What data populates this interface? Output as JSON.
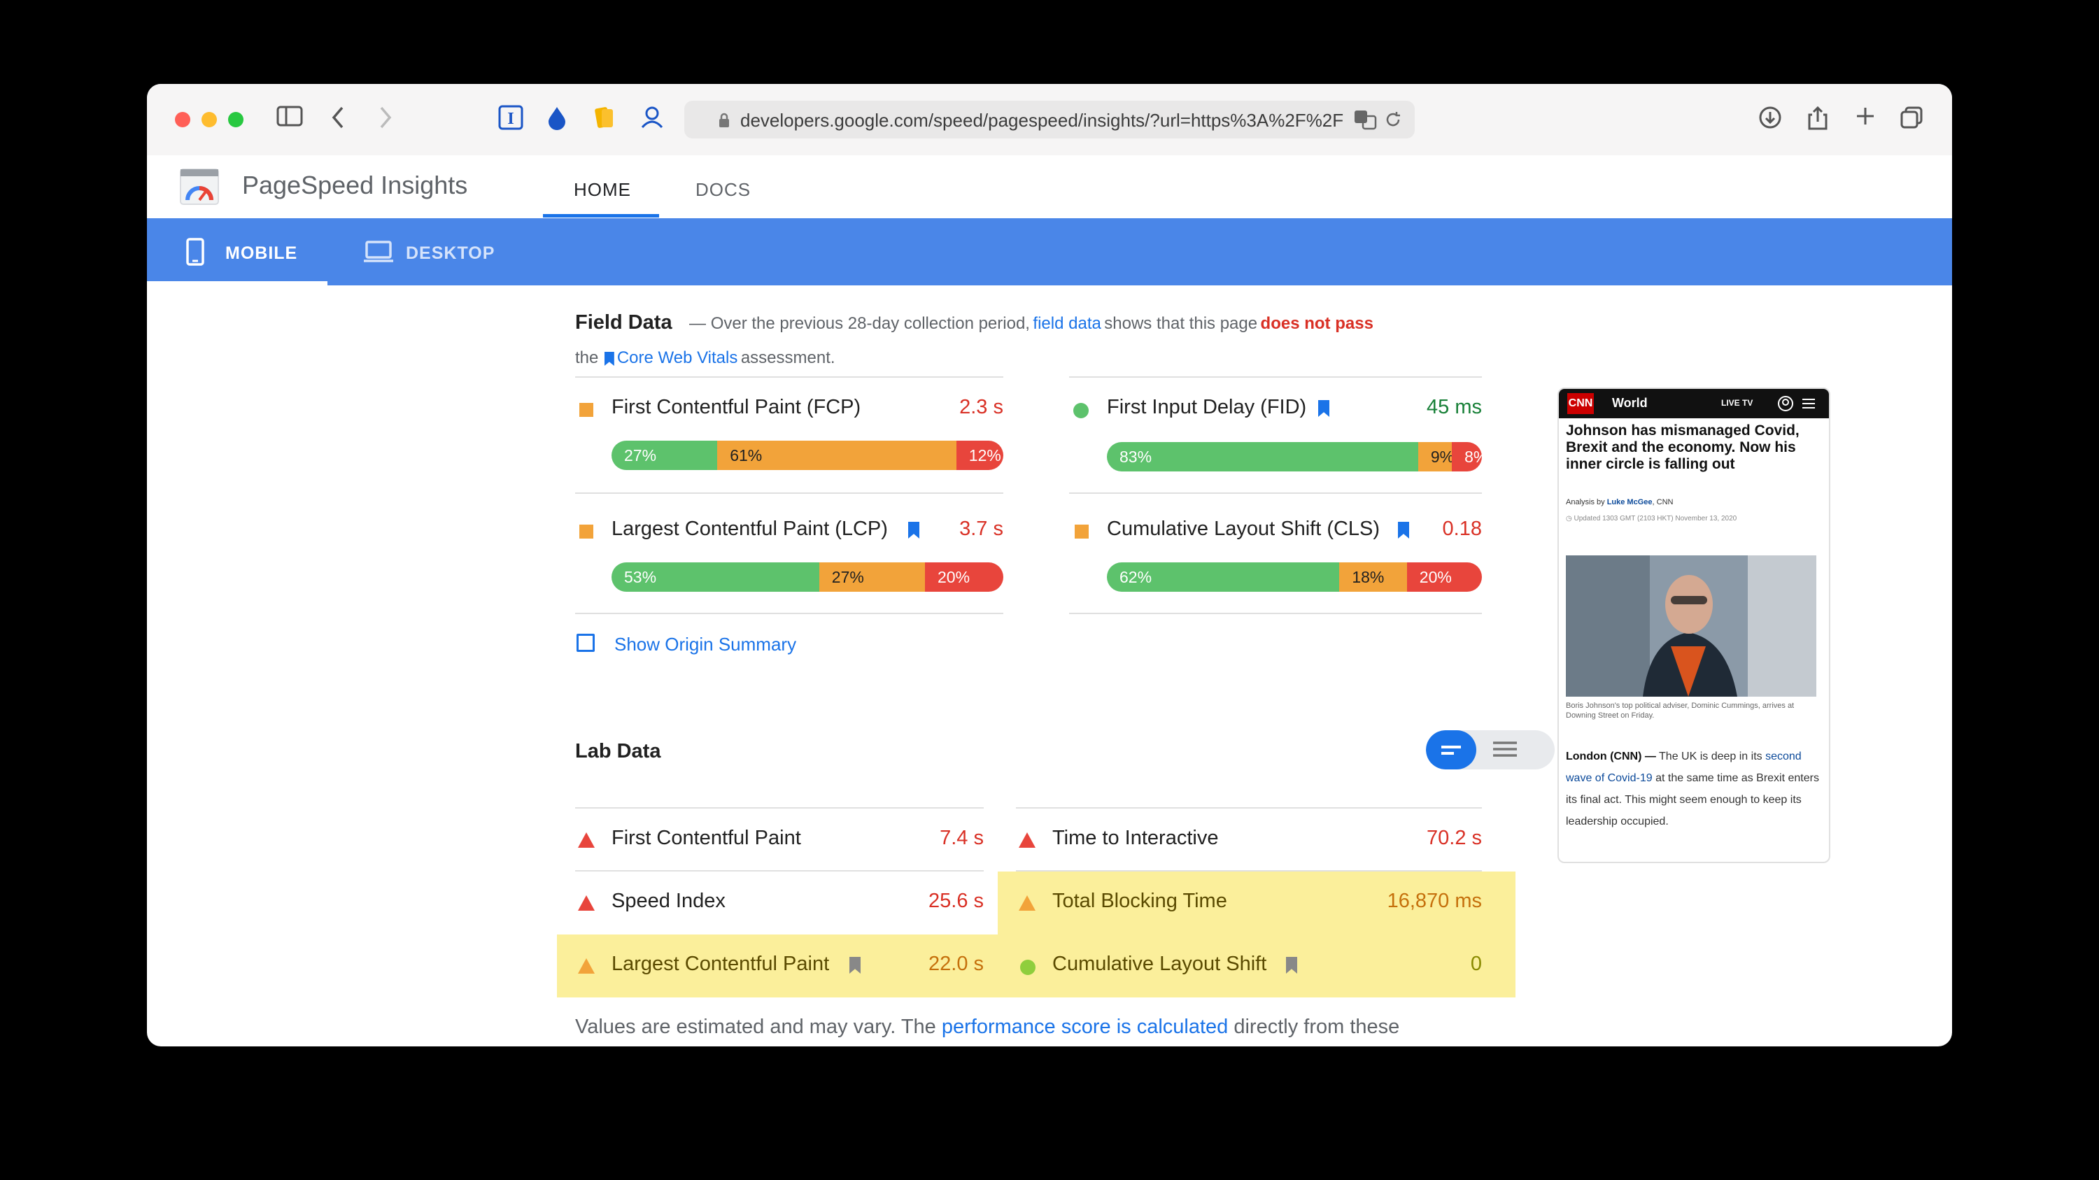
{
  "browser": {
    "url": "developers.google.com/speed/pagespeed/insights/?url=https%3A%2F%2F"
  },
  "header": {
    "brand": "PageSpeed Insights",
    "tabs": [
      {
        "label": "HOME"
      },
      {
        "label": "DOCS"
      }
    ]
  },
  "device_tabs": [
    {
      "label": "MOBILE"
    },
    {
      "label": "DESKTOP"
    }
  ],
  "field_data": {
    "title": "Field Data",
    "desc_prefix": "— Over the previous 28-day collection period,",
    "desc_link": "field data",
    "desc_mid": "shows that this page",
    "desc_fail": "does not pass",
    "desc_the": "the",
    "desc_link2": "Core Web Vitals",
    "desc_end": "assessment.",
    "metrics": [
      {
        "name": "First Contentful Paint (FCP)",
        "value": "2.3 s",
        "dist": [
          "27%",
          "61%",
          "12%"
        ],
        "frac": [
          0.27,
          0.61,
          0.12
        ]
      },
      {
        "name": "First Input Delay (FID)",
        "value": "45 ms",
        "dist": [
          "83%",
          "9%",
          "8%"
        ],
        "frac": [
          0.83,
          0.09,
          0.08
        ]
      },
      {
        "name": "Largest Contentful Paint (LCP)",
        "value": "3.7 s",
        "dist": [
          "53%",
          "27%",
          "20%"
        ],
        "frac": [
          0.53,
          0.27,
          0.2
        ]
      },
      {
        "name": "Cumulative Layout Shift (CLS)",
        "value": "0.18",
        "dist": [
          "62%",
          "18%",
          "20%"
        ],
        "frac": [
          0.62,
          0.18,
          0.2
        ]
      }
    ],
    "origin_summary": "Show Origin Summary"
  },
  "lab_data": {
    "title": "Lab Data",
    "metrics": [
      {
        "name": "First Contentful Paint",
        "value": "7.4 s"
      },
      {
        "name": "Time to Interactive",
        "value": "70.2 s"
      },
      {
        "name": "Speed Index",
        "value": "25.6 s"
      },
      {
        "name": "Total Blocking Time",
        "value": "16,870 ms"
      },
      {
        "name": "Largest Contentful Paint",
        "value": "22.0 s"
      },
      {
        "name": "Cumulative Layout Shift",
        "value": "0"
      }
    ],
    "footer_prefix": "Values are estimated and may vary. The",
    "footer_link": "performance score is calculated",
    "footer_suffix": "directly from these"
  },
  "thumbnail": {
    "logo": "CNN",
    "section": "World",
    "live": "LIVE TV",
    "headline": "Johnson has mismanaged Covid, Brexit and the economy. Now his inner circle is falling out",
    "byline_prefix": "Analysis by",
    "byline_author": "Luke McGee",
    "byline_suffix": ", CNN",
    "updated": "Updated 1303 GMT (2103 HKT) November 13, 2020",
    "caption": "Boris Johnson's top political adviser, Dominic Cummings, arrives at Downing Street on Friday.",
    "body_lead": "London (CNN) —",
    "body_1": "The UK is deep in its",
    "body_link": "second wave of Covid-19",
    "body_2": "at the same time as Brexit enters its final act. This might seem enough to keep its leadership occupied."
  },
  "colors": {
    "good": "#5dc26c",
    "avg": "#f2a33a",
    "poor": "#e8453c",
    "accent": "#1a73e8",
    "highlight": "#fbef9b"
  }
}
